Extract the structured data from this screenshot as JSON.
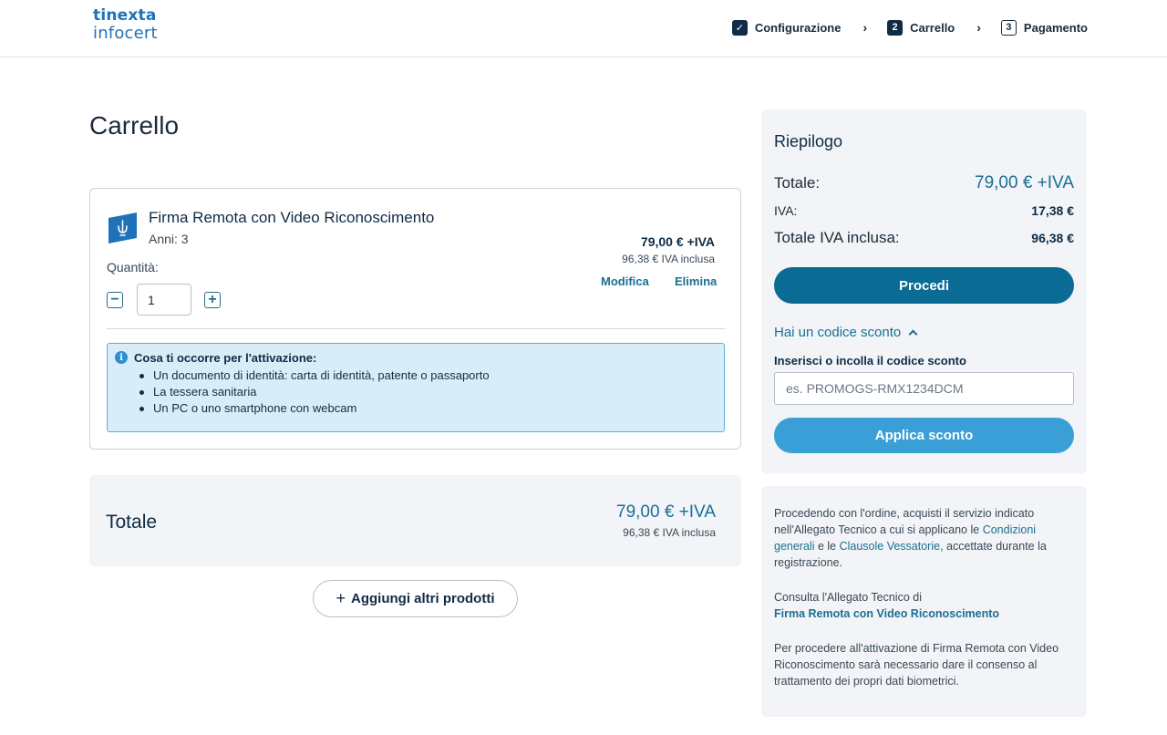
{
  "header": {
    "logo_top": "tinexta",
    "logo_bottom": "infocert",
    "steps": [
      {
        "num": "✓",
        "label": "Configurazione",
        "state": "done"
      },
      {
        "num": "2",
        "label": "Carrello",
        "state": "active"
      },
      {
        "num": "3",
        "label": "Pagamento",
        "state": "todo"
      }
    ],
    "separator": "›"
  },
  "page": {
    "title": "Carrello"
  },
  "product": {
    "name": "Firma Remota con Video Riconoscimento",
    "years": "Anni: 3",
    "price": "79,00 € +IVA",
    "price_incl": "96,38 € IVA inclusa",
    "quantity_label": "Quantità:",
    "quantity_value": "1",
    "minus": "−",
    "plus": "+",
    "edit_label": "Modifica",
    "delete_label": "Elimina",
    "info_title": "Cosa ti occorre per l'attivazione:",
    "info_items": [
      "Un documento di identità: carta di identità, patente o passaporto",
      "La tessera sanitaria",
      "Un PC o uno smartphone con webcam"
    ]
  },
  "total": {
    "label": "Totale",
    "price": "79,00 € +IVA",
    "price_incl": "96,38 € IVA inclusa"
  },
  "add_products": {
    "plus": "+",
    "label": "Aggiungi altri prodotti"
  },
  "summary": {
    "title": "Riepilogo",
    "total_label": "Totale:",
    "total_value": "79,00 € +IVA",
    "vat_label": "IVA:",
    "vat_value": "17,38 €",
    "incl_label": "Totale IVA inclusa:",
    "incl_value": "96,38 €",
    "proceed_label": "Procedi",
    "coupon_toggle": "Hai un codice sconto",
    "coupon_label": "Inserisci o incolla il codice sconto",
    "coupon_placeholder": "es. PROMOGS-RMX1234DCM",
    "apply_label": "Applica sconto"
  },
  "legal": {
    "p1_a": "Procedendo con l'ordine, acquisti il servizio indicato nell'Allegato Tecnico a cui si applicano le ",
    "p1_link1": "Condizioni generali",
    "p1_b": " e le ",
    "p1_link2": "Clausole Vessatorie",
    "p1_c": ", accettate durante la registrazione.",
    "p2_a": "Consulta l'Allegato Tecnico di",
    "p2_link": "Firma Remota con Video Riconoscimento",
    "p3": "Per procedere all'attivazione di Firma Remota con Video Riconoscimento sarà necessario dare il consenso al trattamento dei propri dati biometrici."
  },
  "colors": {
    "brand": "#1f72b8",
    "accent": "#0a6b94",
    "apply": "#3a9fd6",
    "info_bg": "#d7edf8"
  }
}
